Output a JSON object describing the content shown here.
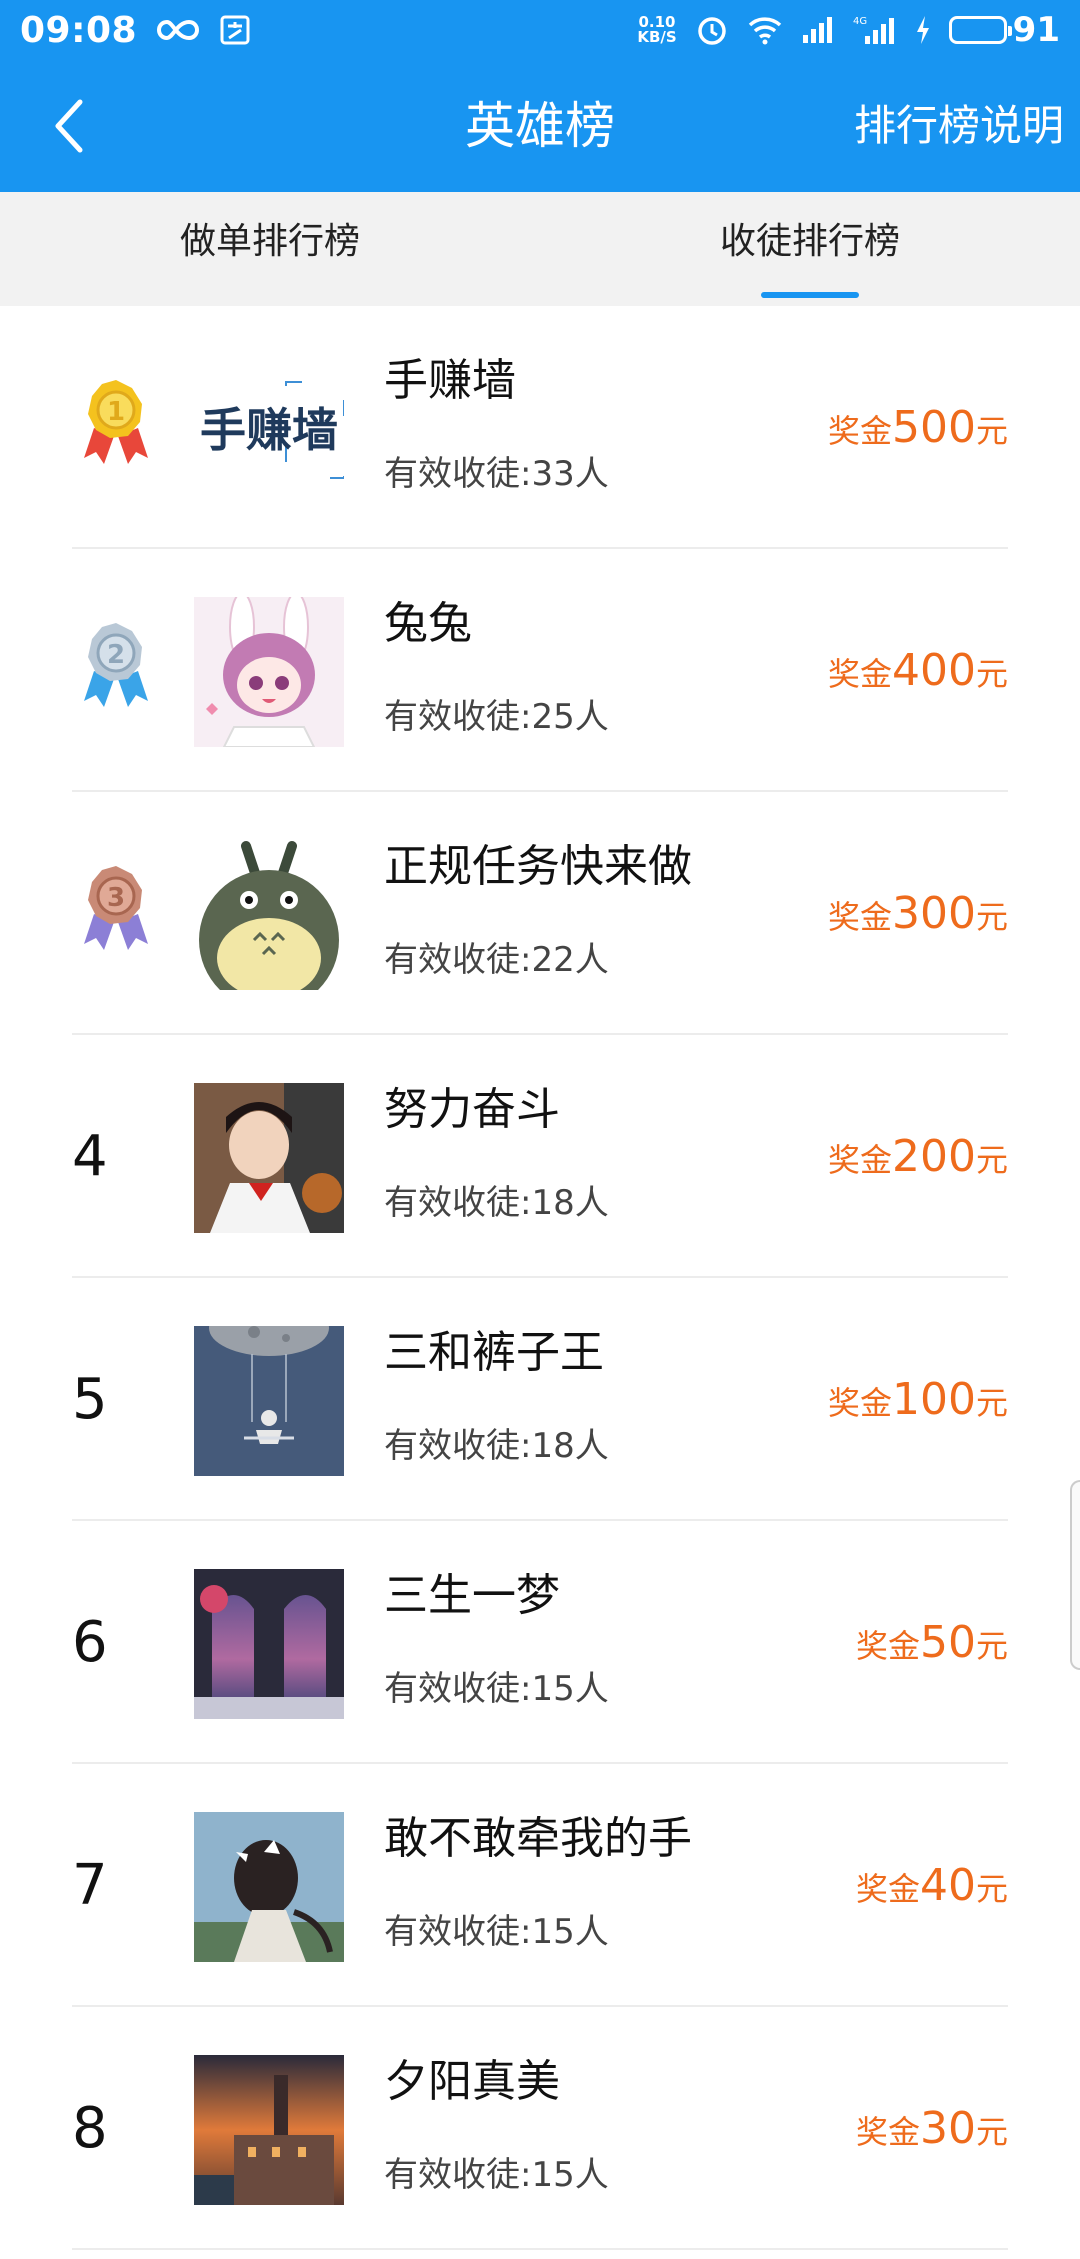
{
  "status_bar": {
    "time": "09:08",
    "net_speed_value": "0.10",
    "net_speed_unit": "KB/S",
    "network_type": "4G",
    "battery": "91"
  },
  "header": {
    "title": "英雄榜",
    "help_label": "排行榜说明"
  },
  "tabs": [
    {
      "label": "做单排行榜",
      "active": false
    },
    {
      "label": "收徒排行榜",
      "active": true
    }
  ],
  "rows": [
    {
      "rank": "1",
      "name": "手赚墙",
      "count": "有效收徒:33人",
      "reward_label": "奖金",
      "reward_amount": "500",
      "reward_unit": "元",
      "avatar": "logo",
      "avatar_text": "手赚墙"
    },
    {
      "rank": "2",
      "name": "兔兔",
      "count": "有效收徒:25人",
      "reward_label": "奖金",
      "reward_amount": "400",
      "reward_unit": "元",
      "avatar": "bunny-girl"
    },
    {
      "rank": "3",
      "name": "正规任务快来做",
      "count": "有效收徒:22人",
      "reward_label": "奖金",
      "reward_amount": "300",
      "reward_unit": "元",
      "avatar": "totoro"
    },
    {
      "rank": "4",
      "name": "努力奋斗",
      "count": "有效收徒:18人",
      "reward_label": "奖金",
      "reward_amount": "200",
      "reward_unit": "元",
      "avatar": "girl-photo"
    },
    {
      "rank": "5",
      "name": "三和裤子王",
      "count": "有效收徒:18人",
      "reward_label": "奖金",
      "reward_amount": "100",
      "reward_unit": "元",
      "avatar": "moon-swing"
    },
    {
      "rank": "6",
      "name": "三生一梦",
      "count": "有效收徒:15人",
      "reward_label": "奖金",
      "reward_amount": "50",
      "reward_unit": "元",
      "avatar": "arch-sunset"
    },
    {
      "rank": "7",
      "name": "敢不敢牵我的手",
      "count": "有效收徒:15人",
      "reward_label": "奖金",
      "reward_amount": "40",
      "reward_unit": "元",
      "avatar": "girl-back"
    },
    {
      "rank": "8",
      "name": "夕阳真美",
      "count": "有效收徒:15人",
      "reward_label": "奖金",
      "reward_amount": "30",
      "reward_unit": "元",
      "avatar": "sunset-town"
    }
  ],
  "colors": {
    "primary": "#1895f1",
    "reward": "#ee6b1c",
    "gold": "#f4c21e",
    "silver": "#b9c8d6",
    "bronze": "#c98a76"
  }
}
